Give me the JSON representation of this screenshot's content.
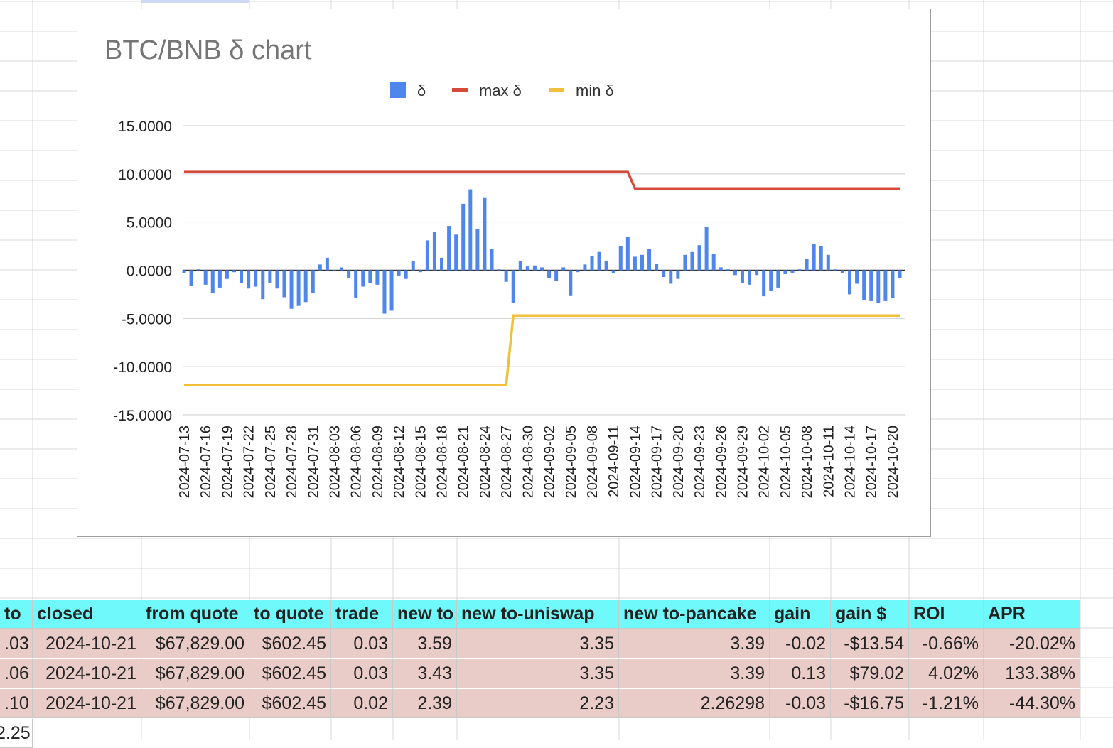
{
  "chart": {
    "title": "BTC/BNB δ chart",
    "legend": [
      {
        "label": "δ",
        "color": "#4f86ec",
        "icon": "bar-swatch-icon"
      },
      {
        "label": "max δ",
        "color": "#d64a3b",
        "icon": "line-swatch-icon"
      },
      {
        "label": "min δ",
        "color": "#f0c03a",
        "icon": "line-swatch-icon"
      }
    ]
  },
  "chart_data": {
    "type": "bar",
    "title": "BTC/BNB δ chart",
    "xlabel": "",
    "ylabel": "",
    "ylim": [
      -15,
      15
    ],
    "yticks": [
      "15.0000",
      "10.0000",
      "5.0000",
      "0.0000",
      "-5.0000",
      "-10.0000",
      "-15.0000"
    ],
    "xtick_labels": [
      "2024-07-13",
      "2024-07-16",
      "2024-07-19",
      "2024-07-22",
      "2024-07-25",
      "2024-07-28",
      "2024-07-31",
      "2024-08-03",
      "2024-08-06",
      "2024-08-09",
      "2024-08-12",
      "2024-08-15",
      "2024-08-18",
      "2024-08-21",
      "2024-08-24",
      "2024-08-27",
      "2024-08-30",
      "2024-09-02",
      "2024-09-05",
      "2024-09-08",
      "2024-09-11",
      "2024-09-14",
      "2024-09-17",
      "2024-09-20",
      "2024-09-23",
      "2024-09-26",
      "2024-09-29",
      "2024-10-02",
      "2024-10-05",
      "2024-10-08",
      "2024-10-11",
      "2024-10-14",
      "2024-10-17",
      "2024-10-20"
    ],
    "grid": true,
    "legend_position": "top",
    "series": [
      {
        "name": "δ",
        "kind": "bar",
        "color": "#4f86ec",
        "values": [
          -0.3,
          -1.6,
          0.1,
          -1.5,
          -2.4,
          -1.8,
          -0.9,
          -0.2,
          -1.3,
          -1.9,
          -1.7,
          -3.0,
          -1.3,
          -1.9,
          -2.8,
          -4.0,
          -3.7,
          -3.3,
          -2.4,
          0.6,
          1.3,
          -0.1,
          0.3,
          -0.8,
          -2.9,
          -1.7,
          -1.3,
          -1.5,
          -4.5,
          -4.2,
          -0.6,
          -0.9,
          1.0,
          -0.2,
          3.1,
          4.0,
          1.3,
          4.6,
          3.7,
          6.9,
          8.4,
          4.3,
          7.5,
          2.2,
          0.1,
          -1.2,
          -3.4,
          1.0,
          0.4,
          0.5,
          0.3,
          -0.8,
          -1.1,
          0.3,
          -2.6,
          -0.2,
          0.6,
          1.5,
          1.9,
          1.0,
          -0.3,
          2.5,
          3.5,
          1.4,
          1.6,
          2.2,
          0.7,
          -0.7,
          -1.4,
          -0.9,
          1.6,
          1.9,
          2.6,
          4.5,
          1.7,
          0.3,
          0.1,
          -0.5,
          -1.3,
          -1.5,
          -0.5,
          -2.7,
          -2.1,
          -1.8,
          -0.4,
          -0.3,
          0.1,
          1.2,
          2.7,
          2.5,
          1.6,
          0.1,
          -0.3,
          -2.5,
          -1.4,
          -3.1,
          -3.2,
          -3.4,
          -3.2,
          -2.9,
          -0.8
        ]
      },
      {
        "name": "max δ",
        "kind": "line",
        "color": "#d64a3b",
        "segments": [
          [
            0,
            10.2
          ],
          [
            62,
            10.2
          ],
          [
            63,
            8.5
          ],
          [
            100,
            8.5
          ]
        ]
      },
      {
        "name": "min δ",
        "kind": "line",
        "color": "#f0c03a",
        "segments": [
          [
            0,
            -11.9
          ],
          [
            45,
            -11.9
          ],
          [
            46,
            -4.7
          ],
          [
            100,
            -4.7
          ]
        ]
      }
    ]
  },
  "table": {
    "headers": [
      "to",
      "closed",
      "from quote",
      "to quote",
      "trade",
      "new to",
      "new to-uniswap",
      "new to-pancake",
      "gain",
      "gain $",
      "ROI",
      "APR"
    ],
    "rows": [
      [
        ".03",
        "2024-10-21",
        "$67,829.00",
        "$602.45",
        "0.03",
        "3.59",
        "3.35",
        "3.39",
        "-0.02",
        "-$13.54",
        "-0.66%",
        "-20.02%"
      ],
      [
        ".06",
        "2024-10-21",
        "$67,829.00",
        "$602.45",
        "0.03",
        "3.43",
        "3.35",
        "3.39",
        "0.13",
        "$79.02",
        "4.02%",
        "133.38%"
      ],
      [
        ".10",
        "2024-10-21",
        "$67,829.00",
        "$602.45",
        "0.02",
        "2.39",
        "2.23",
        "2.26298",
        "-0.03",
        "-$16.75",
        "-1.21%",
        "-44.30%"
      ]
    ],
    "partial_cell": "2.25"
  }
}
